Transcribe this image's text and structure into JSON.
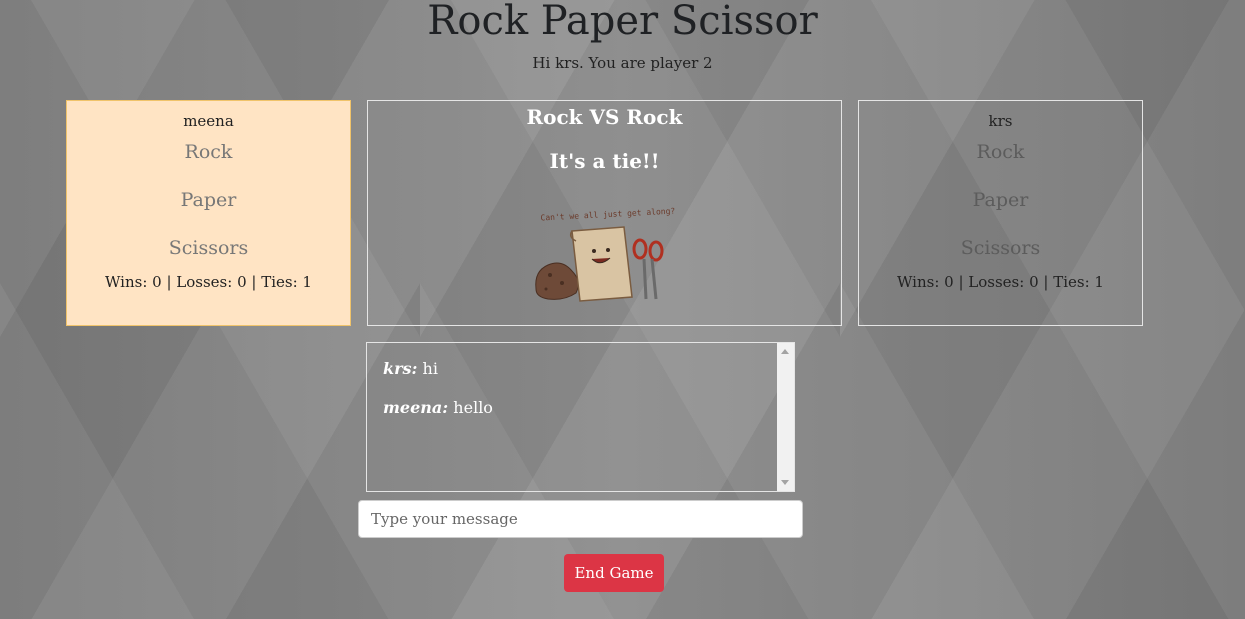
{
  "header": {
    "title": "Rock Paper Scissor",
    "greeting": "Hi krs. You are player 2"
  },
  "player1": {
    "name": "meena",
    "choices": [
      "Rock",
      "Paper",
      "Scissors"
    ],
    "score": "Wins: 0 | Losses: 0 | Ties: 1",
    "highlight_color": "#ffe4c4"
  },
  "player2": {
    "name": "krs",
    "choices": [
      "Rock",
      "Paper",
      "Scissors"
    ],
    "score": "Wins: 0 | Losses: 0 | Ties: 1"
  },
  "result": {
    "matchup": "Rock VS Rock",
    "outcome": "It's a tie!!",
    "illustration_caption": "Can't we all just get along?"
  },
  "chat": {
    "messages": [
      {
        "user": "krs:",
        "text": "hi"
      },
      {
        "user": "meena:",
        "text": "hello"
      }
    ],
    "input_placeholder": "Type your message"
  },
  "actions": {
    "end_game_label": "End Game",
    "end_game_color": "#dc3545"
  }
}
